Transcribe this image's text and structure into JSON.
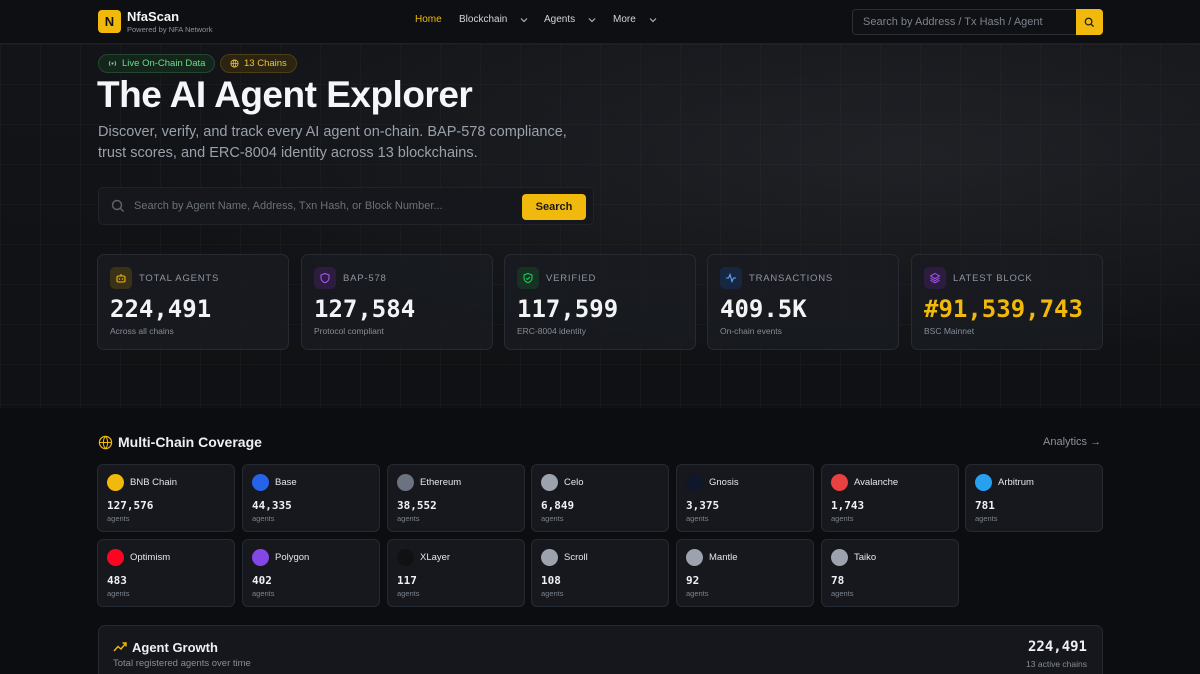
{
  "header": {
    "logo_letter": "N",
    "brand": "NfaScan",
    "brand_sub": "Powered by NFA Network",
    "nav": [
      {
        "label": "Home",
        "active": true
      },
      {
        "label": "Blockchain",
        "dropdown": true
      },
      {
        "label": "Agents",
        "dropdown": true
      },
      {
        "label": "More",
        "dropdown": true
      }
    ],
    "search_placeholder": "Search by Address / Tx Hash / Agent",
    "search_icon": "search-icon"
  },
  "hero": {
    "badges": [
      "Live On-Chain Data",
      "13 Chains"
    ],
    "title": "The AI Agent Explorer",
    "description": "Discover, verify, and track every AI agent on-chain. BAP-578 compliance, trust scores, and ERC-8004 identity across 13 blockchains.",
    "search_placeholder": "Search by Agent Name, Address, Txn Hash, or Block Number...",
    "search_button": "Search"
  },
  "stats": [
    {
      "label": "TOTAL AGENTS",
      "value": "224,491",
      "sub": "Across all chains",
      "icon": "robot-icon",
      "color": "#f0b90b"
    },
    {
      "label": "BAP-578",
      "value": "127,584",
      "sub": "Protocol compliant",
      "icon": "shield-icon",
      "color": "#a855f7"
    },
    {
      "label": "VERIFIED",
      "value": "117,599",
      "sub": "ERC-8004 identity",
      "icon": "shield-check-icon",
      "color": "#22c55e"
    },
    {
      "label": "TRANSACTIONS",
      "value": "409.5K",
      "sub": "On-chain events",
      "icon": "activity-icon",
      "color": "#3b82f6"
    },
    {
      "label": "LATEST BLOCK",
      "value": "#91,539,743",
      "sub": "BSC Mainnet",
      "icon": "layers-icon",
      "color": "#a855f7"
    }
  ],
  "coverage": {
    "title": "Multi-Chain Coverage",
    "analytics_link": "Analytics",
    "unit": "agents",
    "chains": [
      {
        "name": "BNB Chain",
        "count": "127,576",
        "color": "#f0b90b"
      },
      {
        "name": "Base",
        "count": "44,335",
        "color": "#2563eb"
      },
      {
        "name": "Ethereum",
        "count": "38,552",
        "color": "#6b7280"
      },
      {
        "name": "Celo",
        "count": "6,849",
        "color": "#9ca3af"
      },
      {
        "name": "Gnosis",
        "count": "3,375",
        "color": "#0f172a"
      },
      {
        "name": "Avalanche",
        "count": "1,743",
        "color": "#e84142"
      },
      {
        "name": "Arbitrum",
        "count": "781",
        "color": "#28a0f0"
      },
      {
        "name": "Optimism",
        "count": "483",
        "color": "#ff0420"
      },
      {
        "name": "Polygon",
        "count": "402",
        "color": "#8247e5"
      },
      {
        "name": "XLayer",
        "count": "117",
        "color": "#111111"
      },
      {
        "name": "Scroll",
        "count": "108",
        "color": "#9ca3af"
      },
      {
        "name": "Mantle",
        "count": "92",
        "color": "#9ca3af"
      },
      {
        "name": "Taiko",
        "count": "78",
        "color": "#9ca3af"
      }
    ]
  },
  "growth": {
    "title": "Agent Growth",
    "subtitle": "Total registered agents over time",
    "total": "224,491",
    "active_chains": "13 active chains"
  }
}
